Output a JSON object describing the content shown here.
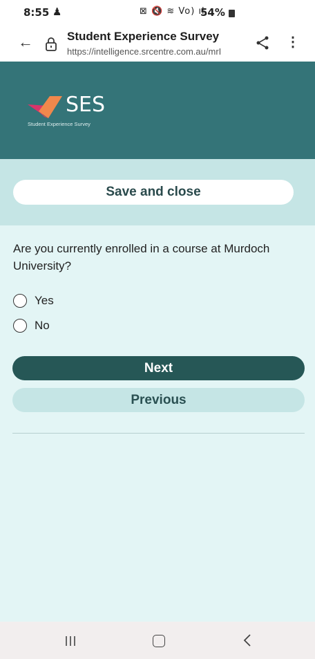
{
  "status_bar": {
    "time": "8:55",
    "person_icon": "person-icon",
    "icons": "⊠ 🔇 ≋ Vo) ıl",
    "battery": "54%"
  },
  "browser": {
    "title": "Student Experience Survey",
    "url": "https://intelligence.srcentre.com.au/mrI",
    "back_icon": "arrow-left-icon",
    "lock_icon": "lock-icon",
    "share_icon": "share-icon",
    "menu_icon": "more-vert-icon"
  },
  "header": {
    "logo_text": "SES",
    "logo_subtitle": "Student Experience Survey",
    "colors": {
      "background": "#347478",
      "logo_pink": "#d9346a",
      "logo_orange": "#f0884c"
    }
  },
  "survey": {
    "save_label": "Save and close",
    "question": "Are you currently enrolled in a course at Murdoch University?",
    "options": [
      {
        "label": "Yes",
        "selected": false
      },
      {
        "label": "No",
        "selected": false
      }
    ],
    "next_label": "Next",
    "previous_label": "Previous"
  },
  "nav_bar": {
    "recents_icon": "recents-icon",
    "home_icon": "home-icon",
    "back_icon": "back-icon"
  }
}
